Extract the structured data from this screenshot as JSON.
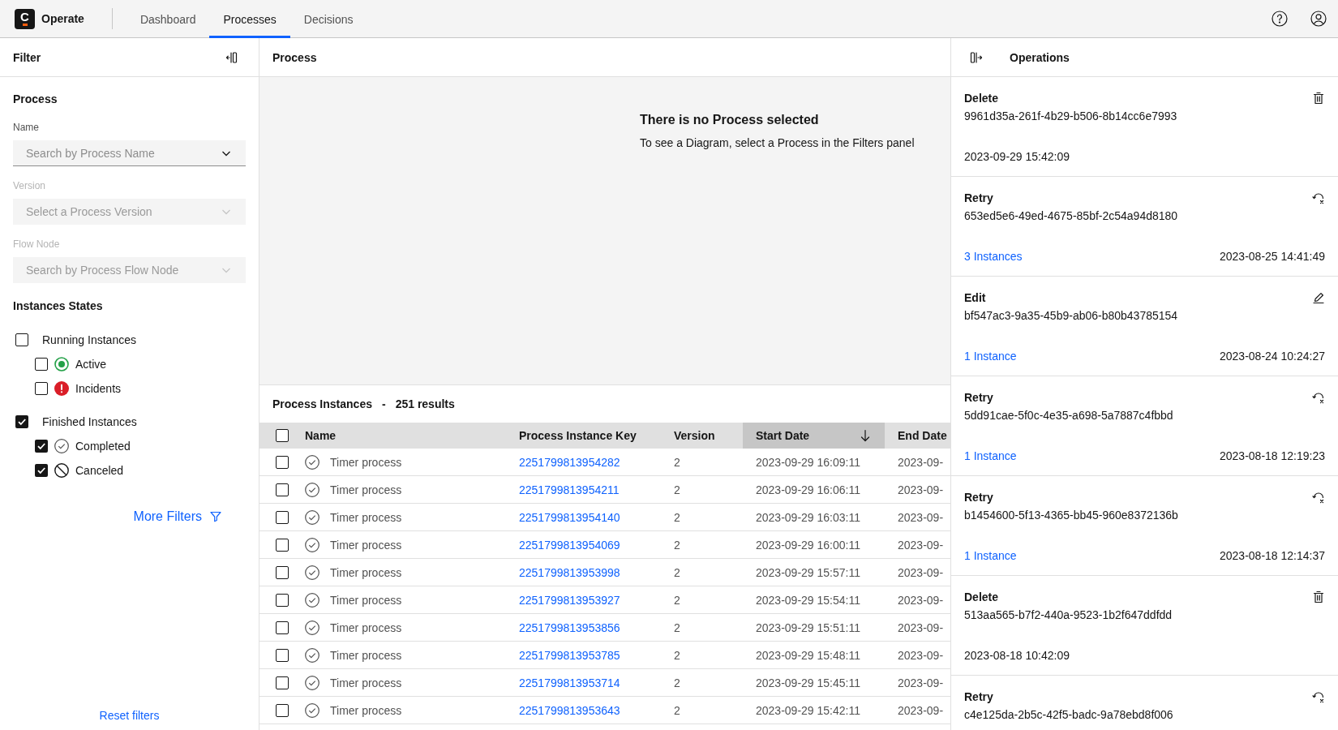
{
  "header": {
    "logo_text": "C",
    "brand": "Operate",
    "tabs": [
      {
        "label": "Dashboard",
        "selected": false
      },
      {
        "label": "Processes",
        "selected": true
      },
      {
        "label": "Decisions",
        "selected": false
      }
    ]
  },
  "filter": {
    "title": "Filter",
    "section": "Process",
    "fields": [
      {
        "label": "Name",
        "placeholder": "Search by Process Name",
        "disabled": false
      },
      {
        "label": "Version",
        "placeholder": "Select a Process Version",
        "disabled": true
      },
      {
        "label": "Flow Node",
        "placeholder": "Search by Process Flow Node",
        "disabled": true
      }
    ],
    "states_title": "Instances States",
    "states": [
      {
        "label": "Running Instances",
        "checked": false,
        "children": [
          {
            "label": "Active",
            "checked": false,
            "kind": "active"
          },
          {
            "label": "Incidents",
            "checked": false,
            "kind": "incident"
          }
        ]
      },
      {
        "label": "Finished Instances",
        "checked": true,
        "children": [
          {
            "label": "Completed",
            "checked": true,
            "kind": "completed"
          },
          {
            "label": "Canceled",
            "checked": true,
            "kind": "canceled"
          }
        ]
      }
    ],
    "more_filters": "More Filters",
    "reset": "Reset filters"
  },
  "process": {
    "title": "Process",
    "empty_title": "There is no Process selected",
    "empty_text": "To see a Diagram, select a Process in the Filters panel"
  },
  "instances": {
    "title": "Process Instances",
    "separator": "-",
    "count": "251 results",
    "all_checked": false,
    "columns": [
      {
        "label": "Name",
        "sorted": false
      },
      {
        "label": "Process Instance Key",
        "sorted": false
      },
      {
        "label": "Version",
        "sorted": false
      },
      {
        "label": "Start Date",
        "sorted": true
      },
      {
        "label": "End Date",
        "sorted": false
      }
    ],
    "rows": [
      {
        "checked": false,
        "kind": "completed",
        "name": "Timer process",
        "key": "2251799813954282",
        "version": "2",
        "start_date": "2023-09-29 16:09:11",
        "end_date": "2023-09-"
      },
      {
        "checked": false,
        "kind": "completed",
        "name": "Timer process",
        "key": "2251799813954211",
        "version": "2",
        "start_date": "2023-09-29 16:06:11",
        "end_date": "2023-09-"
      },
      {
        "checked": false,
        "kind": "completed",
        "name": "Timer process",
        "key": "2251799813954140",
        "version": "2",
        "start_date": "2023-09-29 16:03:11",
        "end_date": "2023-09-"
      },
      {
        "checked": false,
        "kind": "completed",
        "name": "Timer process",
        "key": "2251799813954069",
        "version": "2",
        "start_date": "2023-09-29 16:00:11",
        "end_date": "2023-09-"
      },
      {
        "checked": false,
        "kind": "completed",
        "name": "Timer process",
        "key": "2251799813953998",
        "version": "2",
        "start_date": "2023-09-29 15:57:11",
        "end_date": "2023-09-"
      },
      {
        "checked": false,
        "kind": "completed",
        "name": "Timer process",
        "key": "2251799813953927",
        "version": "2",
        "start_date": "2023-09-29 15:54:11",
        "end_date": "2023-09-"
      },
      {
        "checked": false,
        "kind": "completed",
        "name": "Timer process",
        "key": "2251799813953856",
        "version": "2",
        "start_date": "2023-09-29 15:51:11",
        "end_date": "2023-09-"
      },
      {
        "checked": false,
        "kind": "completed",
        "name": "Timer process",
        "key": "2251799813953785",
        "version": "2",
        "start_date": "2023-09-29 15:48:11",
        "end_date": "2023-09-"
      },
      {
        "checked": false,
        "kind": "completed",
        "name": "Timer process",
        "key": "2251799813953714",
        "version": "2",
        "start_date": "2023-09-29 15:45:11",
        "end_date": "2023-09-"
      },
      {
        "checked": false,
        "kind": "completed",
        "name": "Timer process",
        "key": "2251799813953643",
        "version": "2",
        "start_date": "2023-09-29 15:42:11",
        "end_date": "2023-09-"
      }
    ]
  },
  "operations": {
    "title": "Operations",
    "items": [
      {
        "title": "Delete",
        "kind": "delete",
        "id": "9961d35a-261f-4b29-b506-8b14cc6e7993",
        "date": "2023-09-29 15:42:09"
      },
      {
        "title": "Retry",
        "kind": "retry",
        "id": "653ed5e6-49ed-4675-85bf-2c54a94d8180",
        "instances": "3 Instances",
        "date": "2023-08-25 14:41:49"
      },
      {
        "title": "Edit",
        "kind": "edit",
        "id": "bf547ac3-9a35-45b9-ab06-b80b43785154",
        "instances": "1 Instance",
        "date": "2023-08-24 10:24:27"
      },
      {
        "title": "Retry",
        "kind": "retry",
        "id": "5dd91cae-5f0c-4e35-a698-5a7887c4fbbd",
        "instances": "1 Instance",
        "date": "2023-08-18 12:19:23"
      },
      {
        "title": "Retry",
        "kind": "retry",
        "id": "b1454600-5f13-4365-bb45-960e8372136b",
        "instances": "1 Instance",
        "date": "2023-08-18 12:14:37"
      },
      {
        "title": "Delete",
        "kind": "delete",
        "id": "513aa565-b7f2-440a-9523-1b2f647ddfdd",
        "date": "2023-08-18 10:42:09"
      },
      {
        "title": "Retry",
        "kind": "retry",
        "id": "c4e125da-2b5c-42f5-badc-9a78ebd8f006"
      }
    ]
  }
}
